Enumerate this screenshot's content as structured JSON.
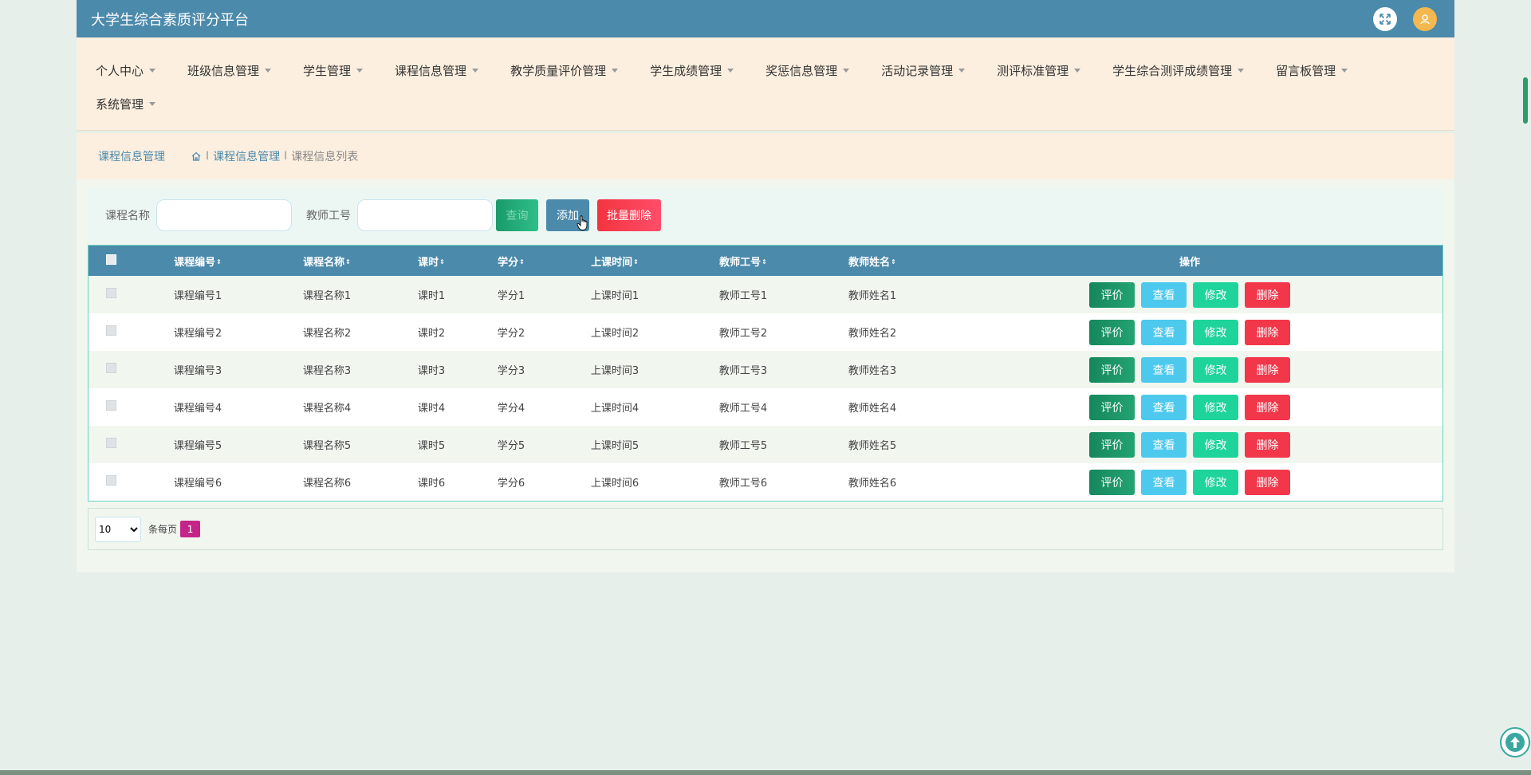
{
  "app": {
    "title": "大学生综合素质评分平台"
  },
  "nav": {
    "row1": [
      "个人中心",
      "班级信息管理",
      "学生管理",
      "课程信息管理",
      "教学质量评价管理",
      "学生成绩管理",
      "奖惩信息管理",
      "活动记录管理",
      "测评标准管理",
      "学生综合测评成绩管理",
      "留言板管理"
    ],
    "row2": [
      "系统管理"
    ]
  },
  "breadcrumb": {
    "page_name": "课程信息管理",
    "sep": "I",
    "level1": "课程信息管理",
    "level2": "课程信息列表"
  },
  "search": {
    "course_name_label": "课程名称",
    "course_name_value": "",
    "teacher_no_label": "教师工号",
    "teacher_no_value": "",
    "query_label": "查询",
    "add_label": "添加",
    "batch_delete_label": "批量删除"
  },
  "table": {
    "headers": [
      "课程编号",
      "课程名称",
      "课时",
      "学分",
      "上课时间",
      "教师工号",
      "教师姓名"
    ],
    "sort_glyph": "⇕",
    "ops_header": "操作",
    "ops": {
      "eval": "评价",
      "view": "查看",
      "edit": "修改",
      "delete": "删除"
    },
    "rows": [
      [
        "课程编号1",
        "课程名称1",
        "课时1",
        "学分1",
        "上课时间1",
        "教师工号1",
        "教师姓名1"
      ],
      [
        "课程编号2",
        "课程名称2",
        "课时2",
        "学分2",
        "上课时间2",
        "教师工号2",
        "教师姓名2"
      ],
      [
        "课程编号3",
        "课程名称3",
        "课时3",
        "学分3",
        "上课时间3",
        "教师工号3",
        "教师姓名3"
      ],
      [
        "课程编号4",
        "课程名称4",
        "课时4",
        "学分4",
        "上课时间4",
        "教师工号4",
        "教师姓名4"
      ],
      [
        "课程编号5",
        "课程名称5",
        "课时5",
        "学分5",
        "上课时间5",
        "教师工号5",
        "教师姓名5"
      ],
      [
        "课程编号6",
        "课程名称6",
        "课时6",
        "学分6",
        "上课时间6",
        "教师工号6",
        "教师姓名6"
      ]
    ]
  },
  "pager": {
    "page_size": "10",
    "per_page_label": "条每页",
    "current_page": "1"
  },
  "colors": {
    "header": "#4b8aab",
    "nav_bg": "#fcefdf",
    "eval": "#16875c",
    "view": "#4ec9ee",
    "edit": "#1fd49a",
    "delete": "#f2374a",
    "page_active": "#c42488"
  }
}
